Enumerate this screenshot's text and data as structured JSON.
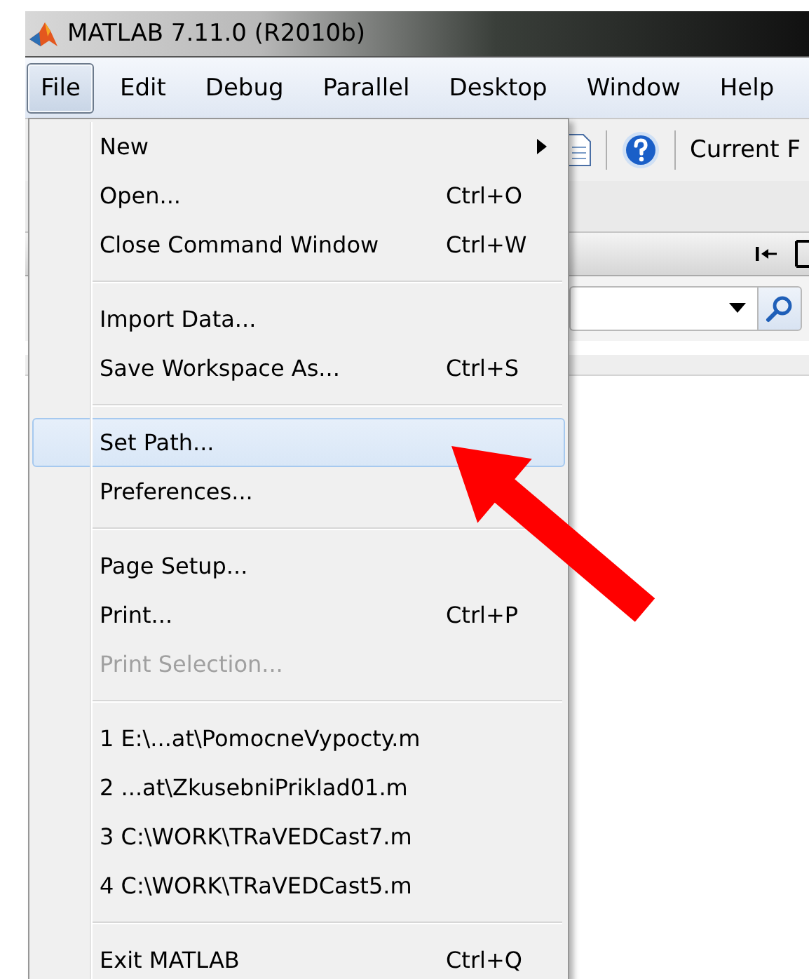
{
  "window": {
    "title": "MATLAB  7.11.0 (R2010b)"
  },
  "menubar": [
    {
      "label": "File",
      "selected": true
    },
    {
      "label": "Edit",
      "selected": false
    },
    {
      "label": "Debug",
      "selected": false
    },
    {
      "label": "Parallel",
      "selected": false
    },
    {
      "label": "Desktop",
      "selected": false
    },
    {
      "label": "Window",
      "selected": false
    },
    {
      "label": "Help",
      "selected": false
    }
  ],
  "toolbar": {
    "current_folder_label": "Current F"
  },
  "file_menu": [
    {
      "kind": "item",
      "label": "New",
      "has_submenu": true,
      "selected": false,
      "disabled": false
    },
    {
      "kind": "item",
      "label": "Open...",
      "shortcut": "Ctrl+O",
      "selected": false,
      "disabled": false
    },
    {
      "kind": "item",
      "label": "Close Command Window",
      "shortcut": "Ctrl+W",
      "selected": false,
      "disabled": false
    },
    {
      "kind": "separator"
    },
    {
      "kind": "item",
      "label": "Import Data...",
      "selected": false,
      "disabled": false
    },
    {
      "kind": "item",
      "label": "Save Workspace As...",
      "shortcut": "Ctrl+S",
      "selected": false,
      "disabled": false
    },
    {
      "kind": "separator"
    },
    {
      "kind": "item",
      "label": "Set Path...",
      "selected": true,
      "disabled": false
    },
    {
      "kind": "item",
      "label": "Preferences...",
      "selected": false,
      "disabled": false
    },
    {
      "kind": "separator"
    },
    {
      "kind": "item",
      "label": "Page Setup...",
      "selected": false,
      "disabled": false
    },
    {
      "kind": "item",
      "label": "Print...",
      "shortcut": "Ctrl+P",
      "selected": false,
      "disabled": false
    },
    {
      "kind": "item",
      "label": "Print Selection...",
      "selected": false,
      "disabled": true
    },
    {
      "kind": "separator"
    },
    {
      "kind": "item",
      "label": "1 E:\\...at\\PomocneVypocty.m",
      "selected": false,
      "disabled": false
    },
    {
      "kind": "item",
      "label": "2 ...at\\ZkusebniPriklad01.m",
      "selected": false,
      "disabled": false
    },
    {
      "kind": "item",
      "label": "3 C:\\WORK\\TRaVEDCast7.m",
      "selected": false,
      "disabled": false
    },
    {
      "kind": "item",
      "label": "4 C:\\WORK\\TRaVEDCast5.m",
      "selected": false,
      "disabled": false
    },
    {
      "kind": "separator"
    },
    {
      "kind": "item",
      "label": "Exit MATLAB",
      "shortcut": "Ctrl+Q",
      "selected": false,
      "disabled": false
    }
  ],
  "annotation": {
    "kind": "arrow",
    "color": "#ff0000"
  }
}
